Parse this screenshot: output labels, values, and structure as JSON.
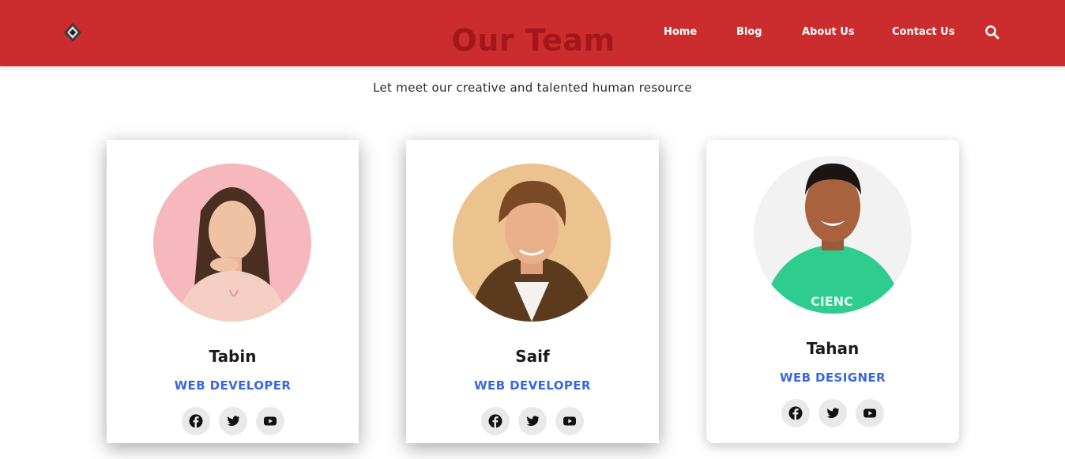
{
  "header": {
    "title": "Our Team",
    "nav": [
      "Home",
      "Blog",
      "About Us",
      "Contact Us"
    ],
    "logo_icon": "diamond-logo-icon",
    "search_icon": "search-icon",
    "background_color": "#cb2d2f",
    "title_color": "#a31619"
  },
  "intro": {
    "subtitle": "Let meet our creative and talented human resource"
  },
  "team": [
    {
      "name": "Tabin",
      "role": "WEB DEVELOPER",
      "photo_bg": "#f7b8bd",
      "socials": [
        "facebook-icon",
        "twitter-icon",
        "youtube-icon"
      ]
    },
    {
      "name": "Saif",
      "role": "WEB DEVELOPER",
      "photo_bg": "#ecc28f",
      "socials": [
        "facebook-icon",
        "twitter-icon",
        "youtube-icon"
      ]
    },
    {
      "name": "Tahan",
      "role": "WEB DESIGNER",
      "photo_bg": "#f2f2f2",
      "socials": [
        "facebook-icon",
        "twitter-icon",
        "youtube-icon"
      ]
    }
  ],
  "colors": {
    "role_accent": "#3a67e0",
    "social_button_bg": "#e9e9e9"
  }
}
